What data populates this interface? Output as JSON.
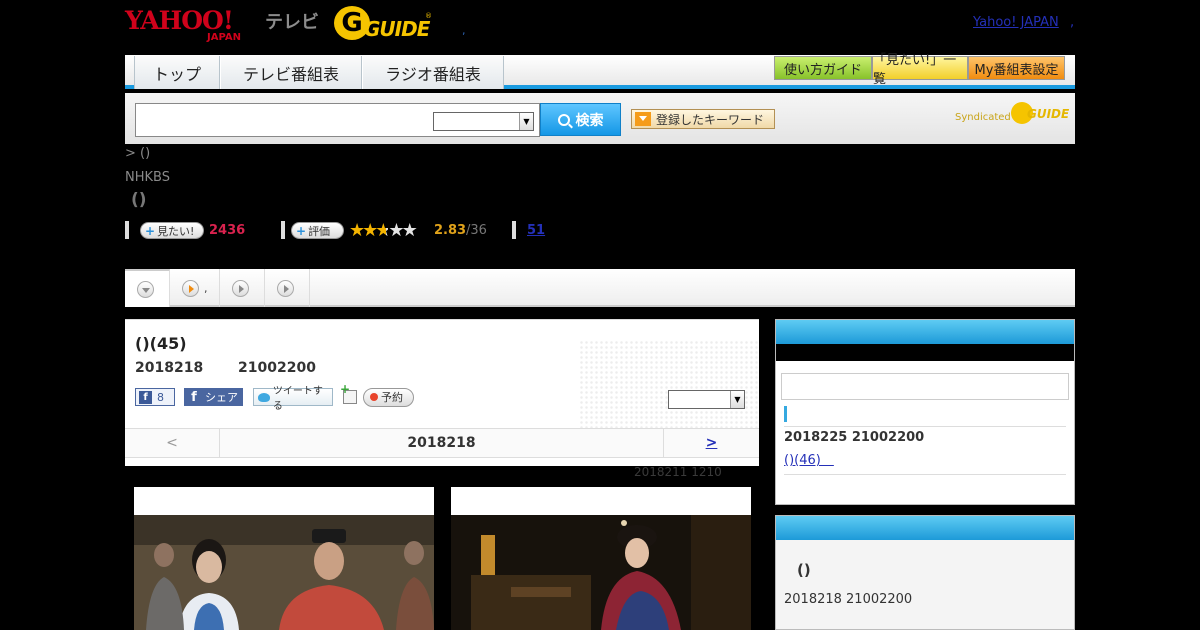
{
  "header": {
    "yahoo_logo": "YAHOO!",
    "yahoo_japan": "JAPAN",
    "tv_label": "テレビ",
    "gguide_logo": "GUIDE",
    "gguide_mark": "®",
    "dot": ",",
    "yahoo_japan_link": "Yahoo! JAPAN",
    "yahoo_japan_comma": ","
  },
  "nav": {
    "tabs": [
      "トップ",
      "テレビ番組表",
      "ラジオ番組表"
    ],
    "buttons": [
      "使い方ガイド",
      "「見たい!」一覧",
      "My番組表設定"
    ]
  },
  "search": {
    "input_value": "",
    "select_value": "",
    "button_label": "検索",
    "keyword_button_label": "登録したキーワード",
    "syndicated_label": "Syndicated",
    "gguide_label": "GUIDE"
  },
  "breadcrumb": ">  ()",
  "channel": "NHKBS",
  "program_title": "()",
  "stats": {
    "want_label": "見たい!",
    "want_count": "2436",
    "rating_label": "評価",
    "rating_value": 2.83,
    "rating_score": "2.83",
    "rating_count": "/36",
    "review_count": "51"
  },
  "tabstrip": {
    "tab2_text": ","
  },
  "episode": {
    "title": "()(45)",
    "date": "2018218",
    "time": "21002200",
    "fb_like_count": "8",
    "fb_share_label": "シェア",
    "tweet_label": "ツイートする",
    "reserve_label": "予約",
    "select_value": ""
  },
  "pager": {
    "prev": "<",
    "current_date": "2018218",
    "next": ">"
  },
  "updated": "2018211  1210",
  "side_next": {
    "date_time": "2018225  21002200",
    "link": "()(46)　"
  },
  "side_related": {
    "title": "()",
    "date_time": "2018218  21002200"
  },
  "colors": {
    "accent_blue": "#1a9be0",
    "want_red": "#d9224e",
    "rating_gold": "#f4b400",
    "link_blue": "#2430b8"
  }
}
